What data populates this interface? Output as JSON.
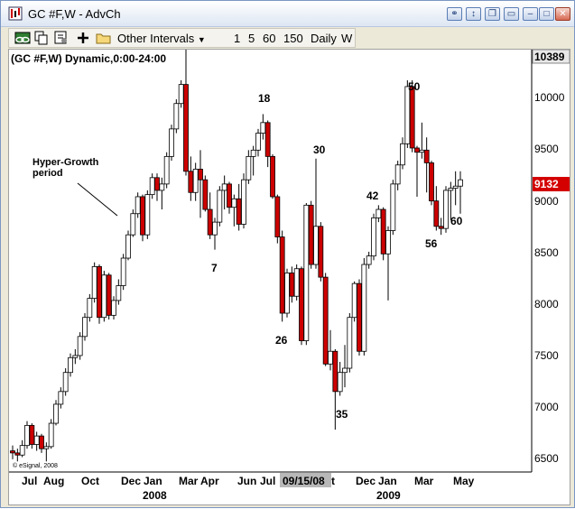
{
  "window": {
    "title": "GC #F,W - AdvCh",
    "title_buttons": [
      "link-icon",
      "size-icon",
      "restore-icon",
      "minimize-icon",
      "maximize-icon",
      "close-icon"
    ]
  },
  "toolbar": {
    "intervals_label": "Other Intervals",
    "intervals": [
      "1",
      "5",
      "60",
      "150",
      "Daily",
      "W"
    ]
  },
  "chart": {
    "header": "(GC #F,W) Dynamic,0:00-24:00",
    "top_price_label": "10389",
    "current_price": "9132",
    "copyright": "© eSignal, 2008",
    "cursor_date": "09/15/08",
    "price_ticks": [
      "10000",
      "9500",
      "9000",
      "8500",
      "8000",
      "7500",
      "7000",
      "6500"
    ],
    "month_labels": [
      "Jul",
      "Aug",
      "Oct",
      "Dec",
      "Jan",
      "Mar",
      "Apr",
      "Jun",
      "Jul",
      "t",
      "Dec",
      "Jan",
      "Mar",
      "May"
    ],
    "year_labels": [
      "2008",
      "2009"
    ],
    "annotations": [
      "Hyper-Growth period",
      "7",
      "18",
      "26",
      "30",
      "35",
      "42",
      "50",
      "56",
      "60"
    ],
    "colors": {
      "up": "#ffffff",
      "down": "#cc0000",
      "outline": "#000000",
      "price_badge": "#d40000"
    }
  },
  "chart_data": {
    "type": "candlestick",
    "title": "(GC #F,W) Dynamic,0:00-24:00",
    "ylim": [
      6400,
      10389
    ],
    "ticks": [
      10000,
      9500,
      9000,
      8500,
      8000,
      7500,
      7000,
      6500
    ],
    "candles": [
      [
        6600,
        6650,
        6520,
        6580
      ],
      [
        6580,
        6620,
        6500,
        6560
      ],
      [
        6560,
        6700,
        6540,
        6650
      ],
      [
        6650,
        6880,
        6620,
        6840
      ],
      [
        6840,
        6860,
        6620,
        6660
      ],
      [
        6660,
        6780,
        6600,
        6740
      ],
      [
        6740,
        6760,
        6580,
        6620
      ],
      [
        6620,
        6680,
        6500,
        6640
      ],
      [
        6640,
        6900,
        6620,
        6860
      ],
      [
        6860,
        7080,
        6840,
        7040
      ],
      [
        7040,
        7200,
        7000,
        7160
      ],
      [
        7160,
        7380,
        7120,
        7340
      ],
      [
        7340,
        7520,
        7300,
        7480
      ],
      [
        7480,
        7560,
        7420,
        7500
      ],
      [
        7500,
        7720,
        7460,
        7680
      ],
      [
        7680,
        7900,
        7640,
        7860
      ],
      [
        7860,
        8080,
        7820,
        8040
      ],
      [
        8040,
        8380,
        8000,
        8340
      ],
      [
        8340,
        8360,
        7800,
        7860
      ],
      [
        7860,
        8300,
        7820,
        8260
      ],
      [
        8260,
        8280,
        7840,
        7880
      ],
      [
        7880,
        8060,
        7840,
        8020
      ],
      [
        8020,
        8220,
        7980,
        8160
      ],
      [
        8160,
        8460,
        8120,
        8420
      ],
      [
        8420,
        8680,
        8400,
        8640
      ],
      [
        8640,
        8880,
        8620,
        8840
      ],
      [
        8840,
        9040,
        8800,
        9000
      ],
      [
        9000,
        9020,
        8580,
        8640
      ],
      [
        8640,
        9060,
        8600,
        9020
      ],
      [
        9020,
        9220,
        8980,
        9180
      ],
      [
        9180,
        9220,
        8960,
        9060
      ],
      [
        9060,
        9180,
        8880,
        9120
      ],
      [
        9120,
        9420,
        9080,
        9380
      ],
      [
        9380,
        9680,
        9340,
        9640
      ],
      [
        9640,
        9920,
        9600,
        9880
      ],
      [
        9880,
        10100,
        9840,
        10060
      ],
      [
        10060,
        10389,
        9200,
        9240
      ],
      [
        9240,
        9380,
        8960,
        9040
      ],
      [
        9040,
        9320,
        8960,
        9260
      ],
      [
        9260,
        9440,
        8800,
        9160
      ],
      [
        9160,
        9200,
        8860,
        8880
      ],
      [
        8880,
        9040,
        8600,
        8640
      ],
      [
        8640,
        8800,
        8500,
        8760
      ],
      [
        8760,
        9100,
        8720,
        9060
      ],
      [
        9060,
        9200,
        8880,
        9120
      ],
      [
        9120,
        9140,
        8840,
        8900
      ],
      [
        8900,
        9020,
        8720,
        8980
      ],
      [
        8980,
        9120,
        8680,
        8740
      ],
      [
        8740,
        9220,
        8700,
        9160
      ],
      [
        9160,
        9440,
        9120,
        9380
      ],
      [
        9380,
        9480,
        9200,
        9440
      ],
      [
        9440,
        9640,
        9380,
        9600
      ],
      [
        9600,
        9780,
        9540,
        9700
      ],
      [
        9700,
        9720,
        9280,
        9380
      ],
      [
        9380,
        9400,
        8980,
        9000
      ],
      [
        9000,
        9020,
        8560,
        8620
      ],
      [
        8620,
        8680,
        7820,
        7900
      ],
      [
        7900,
        8320,
        7860,
        8280
      ],
      [
        8280,
        8340,
        8000,
        8060
      ],
      [
        8060,
        8360,
        8020,
        8320
      ],
      [
        8320,
        8340,
        7600,
        7640
      ],
      [
        7640,
        8940,
        7600,
        8920
      ],
      [
        8920,
        8960,
        8320,
        8360
      ],
      [
        8360,
        9360,
        8320,
        8720
      ],
      [
        8720,
        8760,
        8200,
        8240
      ],
      [
        8240,
        8280,
        7400,
        7420
      ],
      [
        7420,
        7740,
        7360,
        7540
      ],
      [
        7540,
        7560,
        6800,
        7160
      ],
      [
        7160,
        7440,
        7120,
        7340
      ],
      [
        7340,
        7600,
        7200,
        7380
      ],
      [
        7380,
        7900,
        7340,
        7860
      ],
      [
        7860,
        8200,
        7820,
        8180
      ],
      [
        8180,
        8220,
        7500,
        7540
      ],
      [
        7540,
        8420,
        7500,
        8360
      ],
      [
        8360,
        8480,
        8320,
        8440
      ],
      [
        8440,
        8840,
        8400,
        8800
      ],
      [
        8800,
        8920,
        8760,
        8880
      ],
      [
        8880,
        8900,
        8400,
        8460
      ],
      [
        8460,
        8720,
        8020,
        8680
      ],
      [
        8680,
        9160,
        8640,
        9120
      ],
      [
        9120,
        9340,
        9060,
        9300
      ],
      [
        9300,
        9560,
        9260,
        9500
      ],
      [
        9500,
        10100,
        9460,
        10040
      ],
      [
        10040,
        10100,
        9420,
        9460
      ],
      [
        9460,
        9480,
        9000,
        9420
      ],
      [
        9420,
        9700,
        9360,
        9440
      ],
      [
        9440,
        9560,
        9040,
        9320
      ],
      [
        9320,
        9340,
        8920,
        8960
      ],
      [
        8960,
        9100,
        8680,
        8720
      ],
      [
        8720,
        8800,
        8640,
        8700
      ],
      [
        8700,
        9100,
        8660,
        9060
      ],
      [
        9060,
        9140,
        8780,
        9080
      ],
      [
        9080,
        9240,
        8920,
        9100
      ],
      [
        9100,
        9240,
        8840,
        9160
      ]
    ]
  }
}
